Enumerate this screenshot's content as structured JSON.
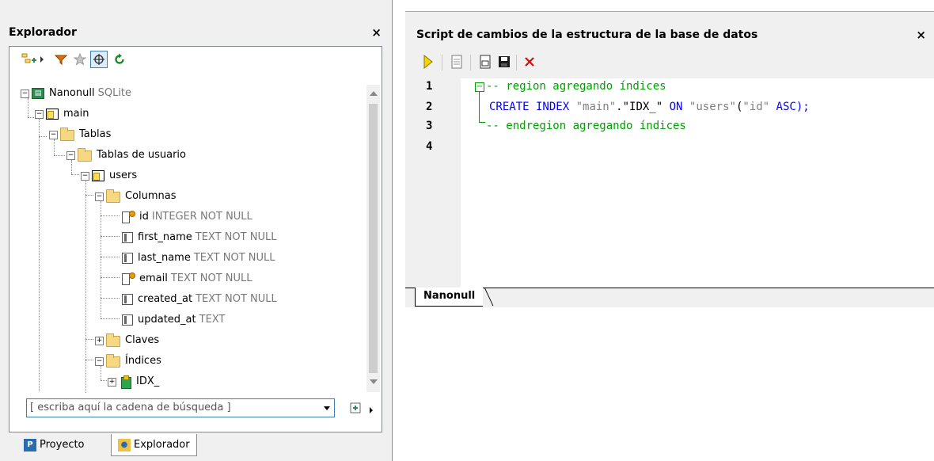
{
  "explorer": {
    "title": "Explorador",
    "close_label": "×",
    "tree": {
      "root": {
        "label": "Nanonull",
        "suffix": "SQLite"
      },
      "schema": "main",
      "tables_folder": "Tablas",
      "user_tables_folder": "Tablas de usuario",
      "table": "users",
      "columns_folder": "Columnas",
      "columns": [
        {
          "name": "id",
          "type": "INTEGER NOT NULL",
          "icon": "primary-key-column-icon"
        },
        {
          "name": "first_name",
          "type": "TEXT NOT NULL",
          "icon": "column-icon"
        },
        {
          "name": "last_name",
          "type": "TEXT NOT NULL",
          "icon": "column-icon"
        },
        {
          "name": "email",
          "type": "TEXT NOT NULL",
          "icon": "unique-key-column-icon"
        },
        {
          "name": "created_at",
          "type": "TEXT NOT NULL",
          "icon": "default-column-icon"
        },
        {
          "name": "updated_at",
          "type": "TEXT",
          "icon": "default-column-icon"
        }
      ],
      "keys_folder": "Claves",
      "indexes_folder": "Índices",
      "index": "IDX_"
    },
    "search": {
      "placeholder": "[ escriba aquí la cadena de búsqueda ]"
    },
    "tabs": [
      {
        "label": "Proyecto"
      },
      {
        "label": "Explorador"
      }
    ]
  },
  "script": {
    "title": "Script de cambios de la estructura de la base de datos",
    "close_label": "×",
    "line_numbers": [
      "1",
      "2",
      "3",
      "4"
    ],
    "lines": {
      "l1": "-- region agregando índices",
      "l2_kw1": "CREATE INDEX",
      "l2_s1": "\"main\"",
      "l2_dot": ".",
      "l2_s2": "\"IDX_\"",
      "l2_kw2": "ON",
      "l2_s3": "\"users\"",
      "l2_p1": "(",
      "l2_s4": "\"id\"",
      "l2_kw3": "ASC",
      "l2_end": ");",
      "l3": "-- endregion agregando índices"
    },
    "tab": "Nanonull"
  },
  "colors": {
    "comment": "#00a000",
    "keyword": "#0000ff",
    "string": "#808080"
  }
}
